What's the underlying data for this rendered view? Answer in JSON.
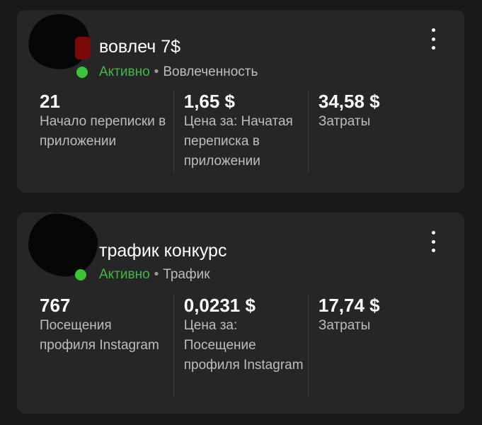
{
  "cards": [
    {
      "title": "вовлеч 7$",
      "status": "Активно",
      "separator": "•",
      "category": "Вовлеченность",
      "menu_icon": "more-vertical-icon",
      "metrics": [
        {
          "value": "21",
          "label": "Начало переписки в приложении"
        },
        {
          "value": "1,65 $",
          "label": "Цена за: Начатая переписка в приложении"
        },
        {
          "value": "34,58 $",
          "label": "Затраты"
        }
      ]
    },
    {
      "title": "трафик конкурс",
      "status": "Активно",
      "separator": "•",
      "category": "Трафик",
      "menu_icon": "more-vertical-icon",
      "metrics": [
        {
          "value": "767",
          "label": "Посещения профиля Instagram"
        },
        {
          "value": "0,0231 $",
          "label": "Цена за: Посещение профиля Instagram"
        },
        {
          "value": "17,74 $",
          "label": "Затраты"
        }
      ]
    }
  ],
  "colors": {
    "background": "#191919",
    "card": "#262626",
    "status_active": "#44b748",
    "status_dot": "#3ec23a",
    "secondary_text": "#bdbdbd"
  }
}
